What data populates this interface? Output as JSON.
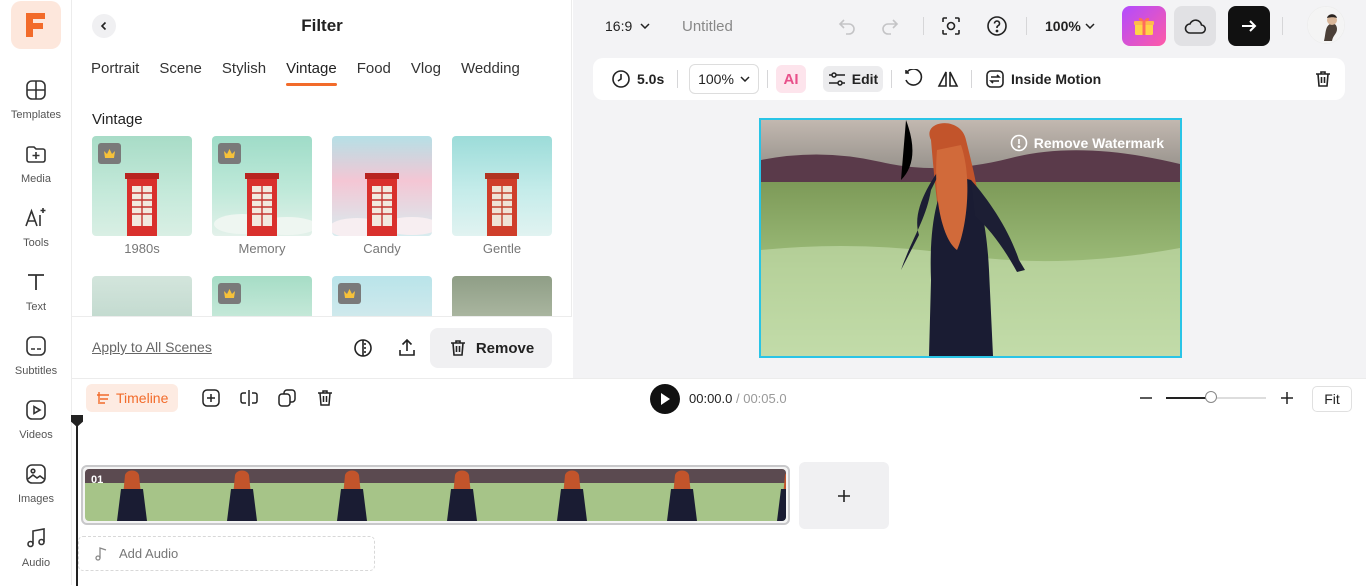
{
  "colors": {
    "accent": "#f26b2a",
    "selection": "#29c4e6",
    "logo_bg": "#fde7dc"
  },
  "rail": {
    "logo_icon": "brand-logo-icon",
    "items": [
      {
        "label": "Templates",
        "icon": "templates-icon"
      },
      {
        "label": "Media",
        "icon": "media-icon"
      },
      {
        "label": "Tools",
        "icon": "ai-tools-icon"
      },
      {
        "label": "Text",
        "icon": "text-icon"
      },
      {
        "label": "Subtitles",
        "icon": "subtitles-icon"
      },
      {
        "label": "Videos",
        "icon": "videos-icon"
      },
      {
        "label": "Images",
        "icon": "images-icon"
      },
      {
        "label": "Audio",
        "icon": "audio-icon"
      }
    ]
  },
  "panel": {
    "title": "Filter",
    "tabs": [
      "Portrait",
      "Scene",
      "Stylish",
      "Vintage",
      "Food",
      "Vlog",
      "Wedding"
    ],
    "active_tab": "Vintage",
    "section_title": "Vintage",
    "filters_row1": [
      {
        "label": "1980s",
        "premium": true
      },
      {
        "label": "Memory",
        "premium": true
      },
      {
        "label": "Candy",
        "premium": false
      },
      {
        "label": "Gentle",
        "premium": false
      }
    ],
    "filters_row2": [
      {
        "premium": false
      },
      {
        "premium": true
      },
      {
        "premium": true
      },
      {
        "premium": false
      }
    ],
    "apply_all": "Apply to All Scenes",
    "remove": "Remove"
  },
  "topbar": {
    "ratio": "16:9",
    "project_name": "Untitled",
    "zoom": "100%"
  },
  "toolbar": {
    "duration": "5.0s",
    "scale": "100%",
    "ai_label": "AI",
    "edit": "Edit",
    "inside_motion": "Inside Motion"
  },
  "canvas": {
    "watermark": "Remove Watermark"
  },
  "timeline": {
    "label": "Timeline",
    "current_time": "00:00.0",
    "separator": " / ",
    "total_time": "00:05.0",
    "fit": "Fit",
    "zoom_level": 0.45,
    "clip_number": "01",
    "add_audio": "Add Audio"
  }
}
